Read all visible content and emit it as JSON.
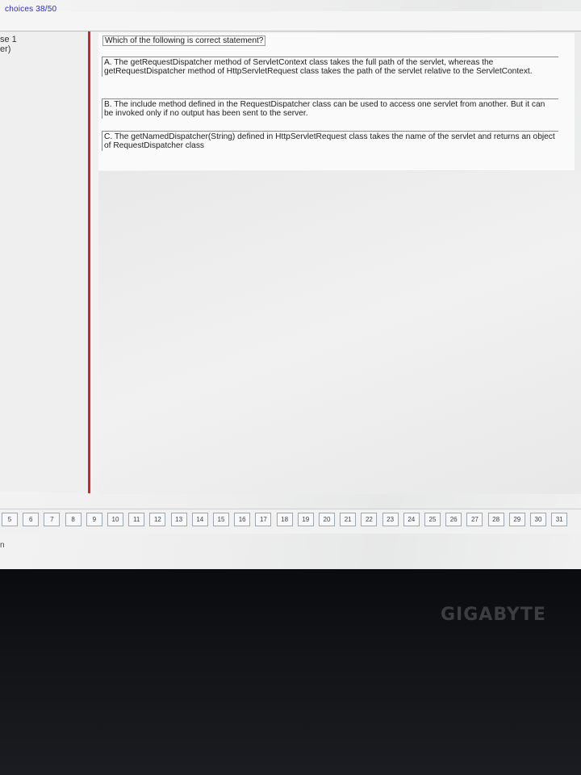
{
  "header": {
    "choices": "choices 38/50"
  },
  "sidebar": {
    "line1": "se 1",
    "line2": "er)"
  },
  "question": {
    "text": "Which of the following is correct statement?",
    "options": [
      {
        "text": "A. The getRequestDispatcher method of ServletContext class takes the full path of the servlet, whereas the getRequestDispatcher method of HttpServletRequest class takes the path of the servlet relative to the ServletContext."
      },
      {
        "text": "B. The include method defined in the RequestDispatcher class can be used to access one servlet from another. But it can be invoked only if no output has been sent to the server."
      },
      {
        "text": "C. The getNamedDispatcher(String) defined in HttpServletRequest class takes the name of the servlet and returns an object of RequestDispatcher class"
      }
    ]
  },
  "nav": {
    "numbers": [
      "5",
      "6",
      "7",
      "8",
      "9",
      "10",
      "11",
      "12",
      "13",
      "14",
      "15",
      "16",
      "17",
      "18",
      "19",
      "20",
      "21",
      "22",
      "23",
      "24",
      "25",
      "26",
      "27",
      "28",
      "29",
      "30",
      "31"
    ]
  },
  "below": {
    "text": "n"
  },
  "monitor": {
    "brand": "GIGABYTE"
  }
}
